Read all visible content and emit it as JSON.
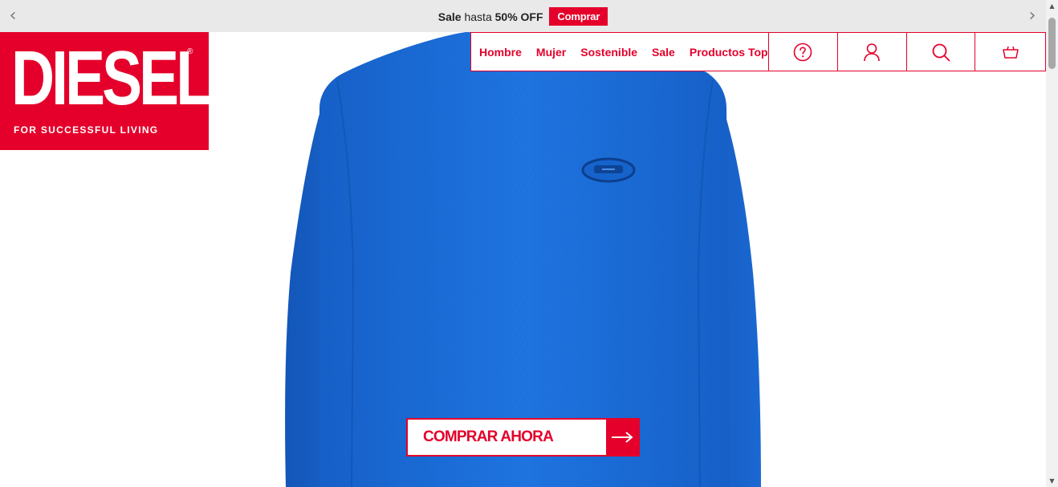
{
  "promo": {
    "prev_icon": "chevron-left-icon",
    "next_icon": "chevron-right-icon",
    "text_bold_1": "Sale",
    "text_mid": "hasta",
    "text_bold_2": "50% OFF",
    "button_label": "Comprar"
  },
  "logo": {
    "wordmark": "DIESEL",
    "registered": "®",
    "tagline": "FOR SUCCESSFUL LIVING"
  },
  "nav": {
    "links": [
      "Hombre",
      "Mujer",
      "Sostenible",
      "Sale",
      "Productos Top"
    ],
    "icons": [
      "help-icon",
      "account-icon",
      "search-icon",
      "basket-icon"
    ]
  },
  "hero": {
    "product_image": "blue-sweatshirt",
    "cta_label": "COMPRAR AHORA",
    "cta_icon": "arrow-right-icon"
  },
  "colors": {
    "brand_red": "#e4002b",
    "product_blue": "#1c6fd9",
    "promo_bg": "#e9e9e9"
  }
}
